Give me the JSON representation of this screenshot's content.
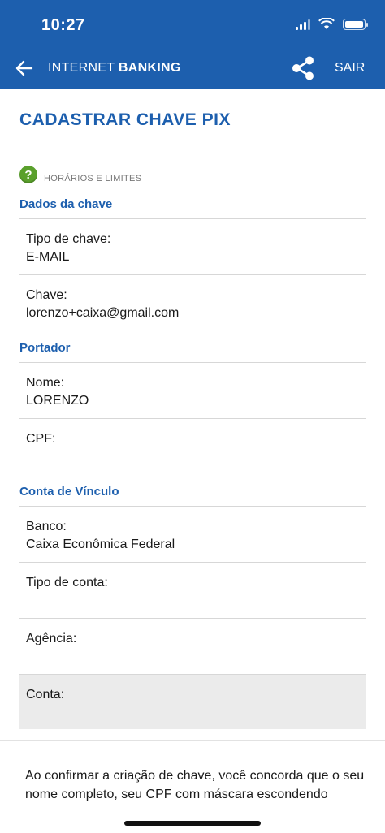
{
  "status_bar": {
    "time": "10:27"
  },
  "nav": {
    "title_light": "INTERNET",
    "title_bold": "BANKING",
    "exit_label": "SAIR"
  },
  "page": {
    "title": "CADASTRAR CHAVE PIX",
    "help_link": "HORÁRIOS E LIMITES"
  },
  "sections": {
    "dados_chave": "Dados da chave",
    "portador": "Portador",
    "conta_vinculo": "Conta de Vínculo"
  },
  "fields": {
    "tipo_chave": {
      "label": "Tipo de chave:",
      "value": "E-MAIL"
    },
    "chave": {
      "label": "Chave:",
      "value": "lorenzo+caixa@gmail.com"
    },
    "nome": {
      "label": "Nome:",
      "value": "LORENZO"
    },
    "cpf": {
      "label": "CPF:",
      "value": ""
    },
    "banco": {
      "label": "Banco:",
      "value": "Caixa Econômica Federal"
    },
    "tipo_conta": {
      "label": "Tipo de conta:",
      "value": ""
    },
    "agencia": {
      "label": "Agência:",
      "value": ""
    },
    "conta": {
      "label": "Conta:",
      "value": ""
    }
  },
  "consent_text": "Ao confirmar a criação de chave, você concorda que o seu nome completo, seu CPF com máscara escondendo",
  "colors": {
    "brand_blue": "#1d5fae",
    "help_green": "#5aa02c"
  }
}
